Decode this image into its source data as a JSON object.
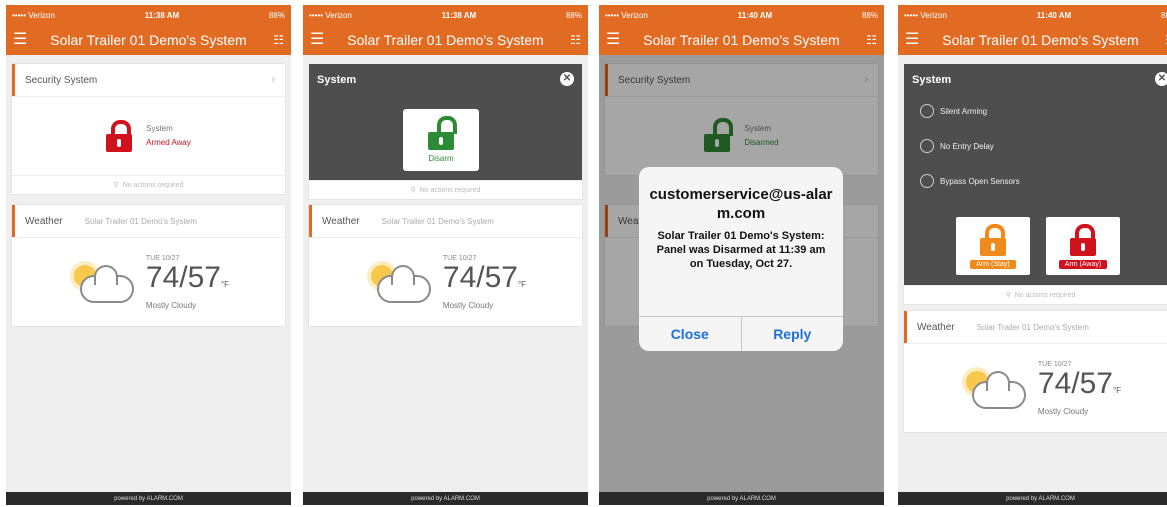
{
  "status": {
    "carrier": "••••• Verizon",
    "battery": "88%"
  },
  "screens": [
    {
      "time": "11:38 AM"
    },
    {
      "time": "11:38 AM"
    },
    {
      "time": "11:40 AM"
    },
    {
      "time": "11:40 AM"
    }
  ],
  "appbar": {
    "title": "Solar Trailer 01 Demo's System"
  },
  "security": {
    "header": "Security System",
    "system_label": "System",
    "state_armed": "Armed Away",
    "state_disarmed": "Disarmed",
    "no_actions": "No actions required"
  },
  "weather": {
    "header": "Weather",
    "location": "Solar Trailer 01 Demo's System",
    "date": "TUE 10/27",
    "temp": "74/57",
    "unit": "°F",
    "desc": "Mostly Cloudy"
  },
  "overlay": {
    "title": "System",
    "disarm": "Disarm"
  },
  "alert": {
    "title": "customerservice@us-alarm.com",
    "message": "Solar Trailer 01 Demo's System: Panel was Disarmed at 11:39 am on Tuesday, Oct 27.",
    "close": "Close",
    "reply": "Reply"
  },
  "arm_panel": {
    "options": [
      "Silent Arming",
      "No Entry Delay",
      "Bypass Open Sensors"
    ],
    "arm_stay": "Arm (Stay)",
    "arm_away": "Arm (Away)"
  },
  "footer": {
    "text": "powered by  ALARM.COM"
  },
  "colors": {
    "accent": "#e26b24",
    "armed": "#d0121d",
    "disarmed": "#2e8b35",
    "stay": "#f18a1c",
    "link": "#1d6fe0"
  }
}
